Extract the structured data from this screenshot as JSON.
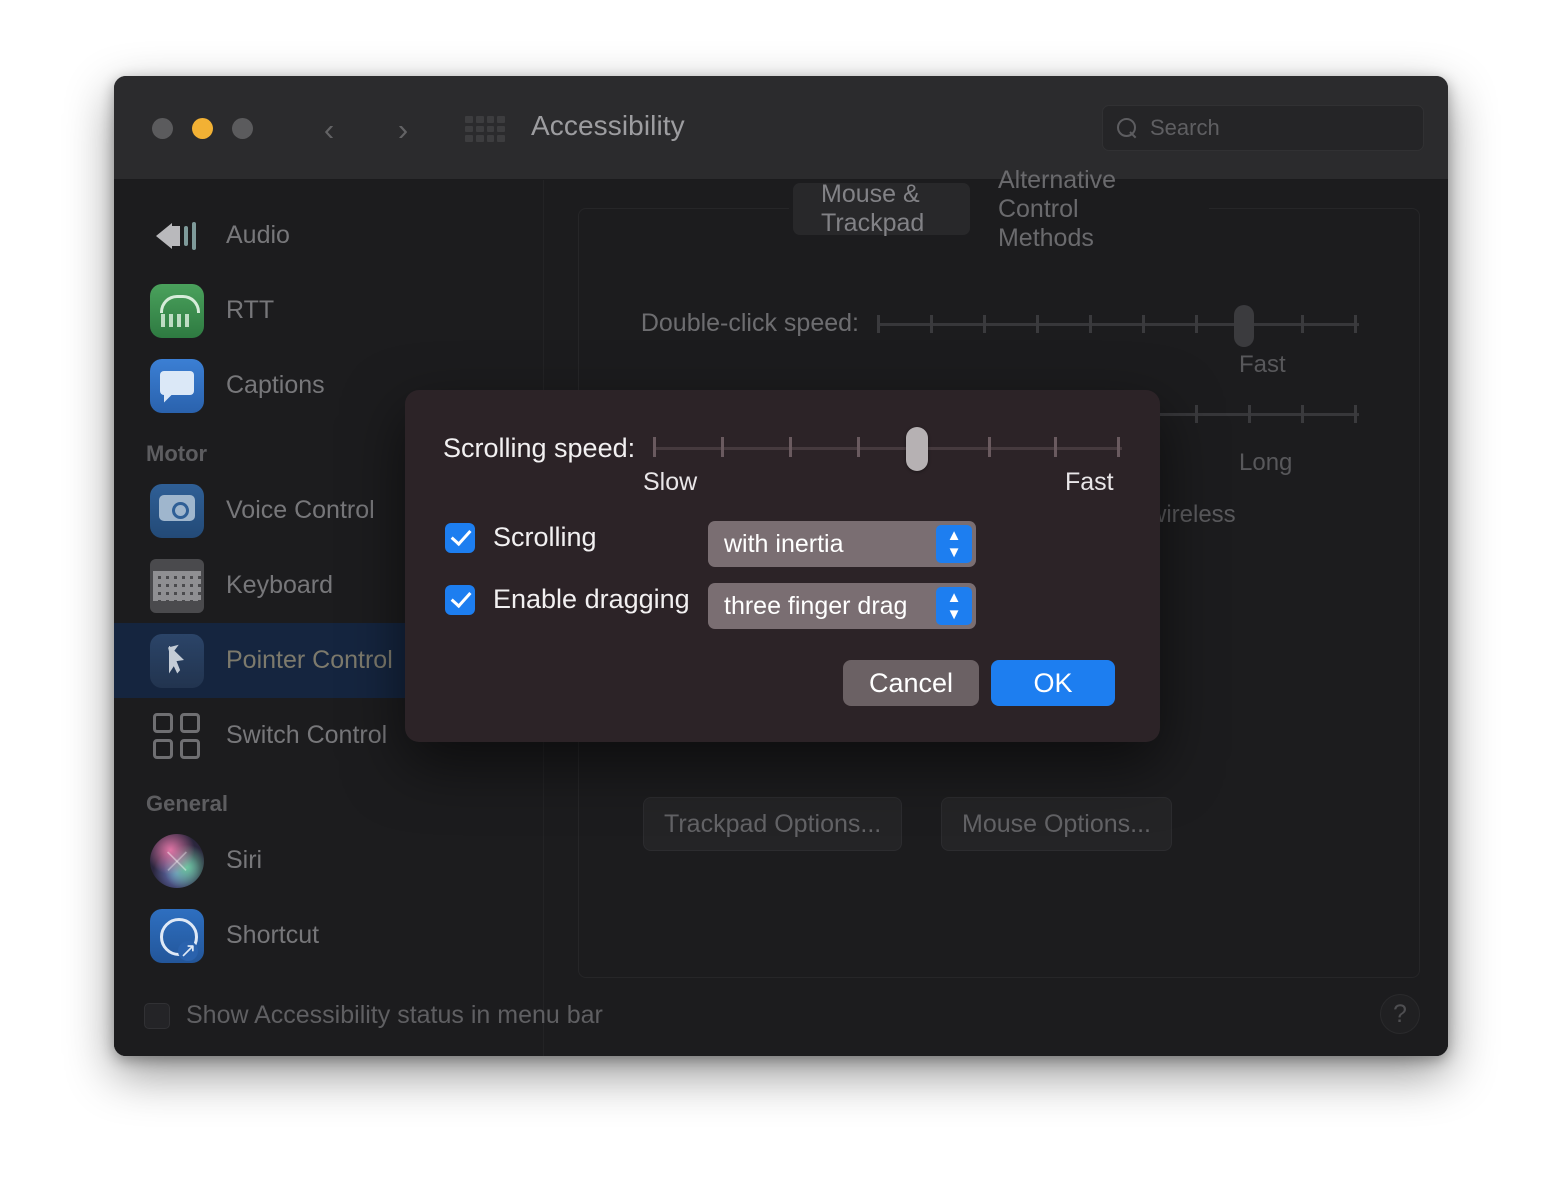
{
  "window": {
    "title": "Accessibility",
    "traffic_lights": [
      "close",
      "minimize",
      "zoom"
    ],
    "nav": {
      "back": "‹",
      "forward": "›"
    },
    "grid_icon": "apps-grid-icon",
    "search": {
      "placeholder": "Search",
      "value": ""
    }
  },
  "sidebar": {
    "items": [
      {
        "label": "Audio",
        "icon": "audio-icon",
        "selected": false
      },
      {
        "label": "RTT",
        "icon": "rtt-icon",
        "selected": false
      },
      {
        "label": "Captions",
        "icon": "captions-icon",
        "selected": false
      }
    ],
    "sections": [
      {
        "header": "Motor",
        "items": [
          {
            "label": "Voice Control",
            "icon": "voice-control-icon",
            "selected": false
          },
          {
            "label": "Keyboard",
            "icon": "keyboard-icon",
            "selected": false
          },
          {
            "label": "Pointer Control",
            "icon": "pointer-control-icon",
            "selected": true
          },
          {
            "label": "Switch Control",
            "icon": "switch-control-icon",
            "selected": false
          }
        ]
      },
      {
        "header": "General",
        "items": [
          {
            "label": "Siri",
            "icon": "siri-icon",
            "selected": false
          },
          {
            "label": "Shortcut",
            "icon": "shortcut-icon",
            "selected": false
          }
        ]
      }
    ]
  },
  "main": {
    "tabs": [
      {
        "label": "Mouse & Trackpad",
        "active": true
      },
      {
        "label": "Alternative Control Methods",
        "active": false
      }
    ],
    "double_click": {
      "label": "Double-click speed:",
      "end_label": "Fast",
      "ticks": 10,
      "value_index": 8
    },
    "spring_delay": {
      "end_label": "Long",
      "ticks": 10,
      "value_index": 10
    },
    "wireless_text": "wireless",
    "buttons": [
      {
        "label": "Trackpad Options..."
      },
      {
        "label": "Mouse Options..."
      }
    ],
    "footer_checkbox": {
      "label": "Show Accessibility status in menu bar",
      "checked": false
    },
    "help_button": "?"
  },
  "dialog": {
    "scrolling_speed": {
      "label": "Scrolling speed:",
      "slow_label": "Slow",
      "fast_label": "Fast",
      "ticks": 9,
      "value_index": 4
    },
    "options": [
      {
        "checkbox_label": "Scrolling",
        "checked": true,
        "popup_value": "with inertia"
      },
      {
        "checkbox_label": "Enable dragging",
        "checked": true,
        "popup_value": "three finger drag"
      }
    ],
    "buttons": {
      "cancel": "Cancel",
      "ok": "OK"
    }
  },
  "colors": {
    "accent_blue": "#1d7ef0",
    "window_bg": "#1c1c1e",
    "titlebar_bg": "#2b2b2d",
    "dialog_bg": "#2c2327",
    "selected_row": "#15253f",
    "traffic_yellow": "#f2b134"
  }
}
